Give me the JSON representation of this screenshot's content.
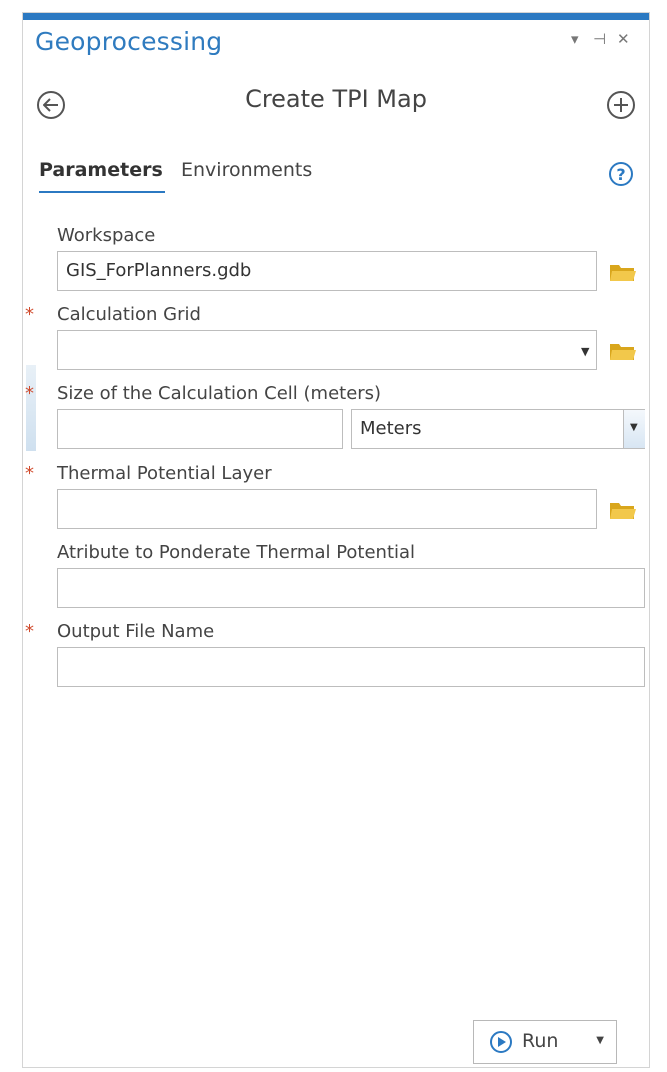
{
  "pane": {
    "title": "Geoprocessing",
    "controls": {
      "menu": "▾",
      "pin": "⊣",
      "close": "✕"
    }
  },
  "header": {
    "back_icon": "back-arrow-icon",
    "tool_name": "Create TPI Map",
    "add_icon": "add-icon"
  },
  "tabs": [
    {
      "label": "Parameters",
      "active": true
    },
    {
      "label": "Environments",
      "active": false
    }
  ],
  "help_glyph": "?",
  "parameters": {
    "workspace": {
      "label": "Workspace",
      "value": "GIS_ForPlanners.gdb",
      "required": false
    },
    "calculation_grid": {
      "label": "Calculation Grid",
      "value": "",
      "required": true
    },
    "cell_size": {
      "label": "Size of the Calculation Cell (meters)",
      "value": "",
      "unit": "Meters",
      "required": true
    },
    "thermal_layer": {
      "label": "Thermal Potential Layer",
      "value": "",
      "required": true
    },
    "attribute": {
      "label": "Atribute to Ponderate Thermal Potential",
      "value": "",
      "required": false
    },
    "output_name": {
      "label": "Output File Name",
      "value": "",
      "required": true
    }
  },
  "required_marker": "*",
  "run_button": {
    "label": "Run"
  },
  "colors": {
    "accent": "#2b79c2",
    "required": "#d04a2c",
    "folder": "#e8b923"
  }
}
